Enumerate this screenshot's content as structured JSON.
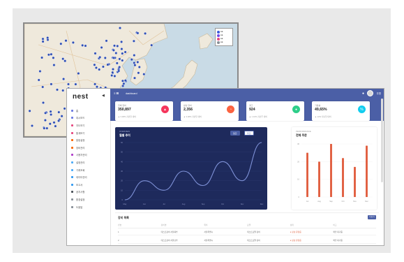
{
  "map": {
    "legend": [
      {
        "label": "●●",
        "color": "#3b5bdb"
      },
      {
        "label": "●●",
        "color": "#7048e8"
      },
      {
        "label": "●●",
        "color": "#e64980"
      },
      {
        "label": "●●",
        "color": "#868e96"
      }
    ],
    "pin_color": "#2f4fb5",
    "water_color": "#c9dbe6",
    "land_color": "#efe9dc"
  },
  "dashboard": {
    "logo": "nest",
    "topbar": {
      "brand": "≡ B",
      "crumb": "dashboard",
      "user": "무명"
    },
    "sidebar": {
      "items": [
        {
          "label": "홈",
          "color": "#6c7ae0"
        },
        {
          "label": "대시보드",
          "color": "#6c7ae0"
        },
        {
          "label": "지도보기",
          "color": "#e64980"
        },
        {
          "label": "통계보기",
          "color": "#e64980"
        },
        {
          "label": "알림설정",
          "color": "#f76707"
        },
        {
          "label": "장비관리",
          "color": "#f76707"
        },
        {
          "label": "사용자관리",
          "color": "#ae3ec9"
        },
        {
          "label": "설정관리",
          "color": "#4dabf7"
        },
        {
          "label": "기록조회",
          "color": "#4dabf7"
        },
        {
          "label": "데이터관리",
          "color": "#339af0"
        },
        {
          "label": "보고서",
          "color": "#339af0"
        },
        {
          "label": "공지사항",
          "color": "#495057"
        },
        {
          "label": "환경설정",
          "color": "#868e96"
        },
        {
          "label": "도움말",
          "color": "#868e96"
        }
      ]
    },
    "cards": [
      {
        "label": "전체 장비",
        "value": "350,897",
        "sub": "▲ 3.48% 지난달 대비",
        "color": "#f5365c",
        "icon": "chart-icon"
      },
      {
        "label": "활성 장비",
        "value": "2,356",
        "sub": "▲ 3.48% 지난달 대비",
        "color": "#fb6340",
        "icon": "pie-icon"
      },
      {
        "label": "경고",
        "value": "924",
        "sub": "▲ 1.10% 지난주 대비",
        "color": "#2dce89",
        "icon": "users-icon"
      },
      {
        "label": "가동률",
        "value": "49,65%",
        "sub": "▲ 12% 지난달 대비",
        "color": "#11cdef",
        "icon": "percent-icon"
      }
    ],
    "line_panel": {
      "subtitle": "OVERVIEW",
      "title": "월별 추이",
      "btn_a": "월간",
      "btn_b": "주간"
    },
    "bar_panel": {
      "subtitle": "PERFORMANCE",
      "title": "전체 주문"
    },
    "table": {
      "title": "장비 목록",
      "button": "더보기",
      "headers": [
        "번호",
        "장비명",
        "위치",
        "모델",
        "상태",
        "비고"
      ],
      "rows": [
        [
          "1",
          "테스트장비 서울북부",
          "서울특별시",
          "테스트모델 장비",
          "● 정상 운영중",
          "확인 대기중"
        ],
        [
          "2",
          "테스트장비 서울남부",
          "서울특별시",
          "테스트모델 장비",
          "● 정상 운영중",
          "확인 대기중"
        ]
      ]
    }
  },
  "chart_data": [
    {
      "type": "line",
      "x": [
        "May",
        "Jun",
        "Jul",
        "Aug",
        "Sep",
        "Oct",
        "Nov",
        "Dec"
      ],
      "series": [
        {
          "values": [
            0,
            20,
            10,
            30,
            15,
            40,
            20,
            60
          ]
        }
      ],
      "ylim": [
        0,
        60
      ],
      "yticks": [
        "0",
        "10",
        "20",
        "30",
        "40",
        "50",
        "60"
      ],
      "line_color": "#7f92d8",
      "grid": true
    },
    {
      "type": "bar",
      "categories": [
        "Jul",
        "Aug",
        "Sep",
        "Oct",
        "Nov",
        "Dec"
      ],
      "values": [
        25,
        20,
        30,
        22,
        17,
        29
      ],
      "ylim": [
        0,
        30
      ],
      "yticks": [
        "0",
        "10",
        "20",
        "30"
      ],
      "bar_color": "#e05a3a",
      "grid": true
    }
  ]
}
